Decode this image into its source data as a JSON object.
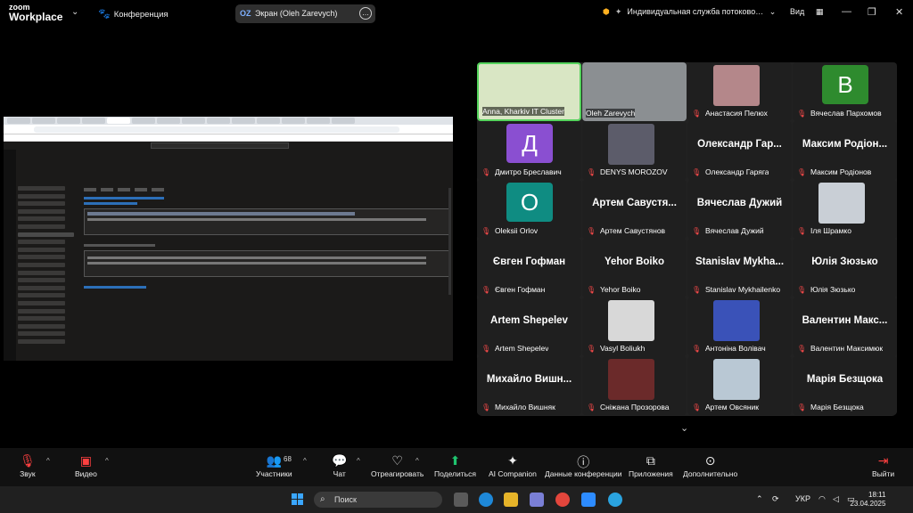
{
  "top": {
    "logo_line1": "zoom",
    "logo_line2": "Workplace",
    "conference": "Конференция",
    "screen_initials": "OZ",
    "screen_label": "Экран (Oleh Zarevych)",
    "streaming": "Индивидуальная служба потоково…",
    "view": "Вид"
  },
  "tiles": [
    {
      "name": "Anna, Kharkiv IT Cluster",
      "speaker": true,
      "type": "video",
      "bg": "#d9e6c4"
    },
    {
      "name": "Oleh Zarevych",
      "type": "video",
      "bg": "#8b8f92"
    },
    {
      "name": "Анастасия Пелюх",
      "type": "photo",
      "bg": "#b4878a"
    },
    {
      "name": "Вячеслав Пархомов",
      "type": "initial",
      "initial": "В",
      "bg": "#2e8b2e"
    },
    {
      "name": "Дмитро Бреславич",
      "type": "initial",
      "initial": "Д",
      "bg": "#8a4fd1"
    },
    {
      "name": "DENYS MOROZOV",
      "type": "photo",
      "bg": "#5c5c6a"
    },
    {
      "name": "Олександр Гаряга",
      "type": "text",
      "big": "Олександр Гар..."
    },
    {
      "name": "Максим Родіонов",
      "type": "text",
      "big": "Максим Родіон..."
    },
    {
      "name": "Oleksii Orlov",
      "type": "initial",
      "initial": "O",
      "bg": "#0f8c82"
    },
    {
      "name": "Артем Савустянов",
      "type": "text",
      "big": "Артем Савустя..."
    },
    {
      "name": "Вячеслав Дужий",
      "type": "text",
      "big": "Вячеслав Дужий"
    },
    {
      "name": "Іля Шрамко",
      "type": "photo",
      "bg": "#c9cfd6"
    },
    {
      "name": "Євген Гофман",
      "type": "text",
      "big": "Євген Гофман"
    },
    {
      "name": "Yehor Boiko",
      "type": "text",
      "big": "Yehor Boiko"
    },
    {
      "name": "Stanislav Mykhailenko",
      "type": "text",
      "big": "Stanislav Mykha..."
    },
    {
      "name": "Юлія Зюзько",
      "type": "text",
      "big": "Юлія Зюзько"
    },
    {
      "name": "Artem Shepelev",
      "type": "text",
      "big": "Artem Shepelev"
    },
    {
      "name": "Vasyl Boliukh",
      "type": "photo",
      "bg": "#d8d8d8"
    },
    {
      "name": "Антоніна Волівач",
      "type": "photo",
      "bg": "#3a52b8"
    },
    {
      "name": "Валентин Максимюк",
      "type": "text",
      "big": "Валентин Макс..."
    },
    {
      "name": "Михайло Вишняк",
      "type": "text",
      "big": "Михайло Вишн..."
    },
    {
      "name": "Сніжана Прозорова",
      "type": "photo",
      "bg": "#6b2a2a"
    },
    {
      "name": "Артем Овсяник",
      "type": "photo",
      "bg": "#b9c8d4"
    },
    {
      "name": "Марія Безщока",
      "type": "text",
      "big": "Марія Безщока"
    }
  ],
  "toolbar": {
    "audio": "Звук",
    "video": "Видео",
    "participants": "Участники",
    "participants_count": "68",
    "chat": "Чат",
    "react": "Отреагировать",
    "share": "Поделиться",
    "ai": "AI Companion",
    "info": "Данные конференции",
    "apps": "Приложения",
    "more": "Дополнительно",
    "leave": "Выйти"
  },
  "taskbar": {
    "search": "Поиск",
    "lang": "УКР",
    "time": "18:11",
    "date": "23.04.2025"
  },
  "colors": {
    "accent_green": "#54d35c",
    "muted_red": "#ff4040",
    "share_green": "#1fc46f"
  }
}
